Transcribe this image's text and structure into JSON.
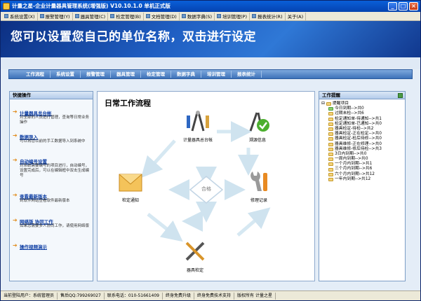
{
  "window": {
    "title": "计量之星-企业计量器具管理系统(增强版)  V10.10.1.0 单机正式版"
  },
  "menu": [
    "系统设置(X)",
    "报警管理(Y)",
    "器具管理(C)",
    "检定管理(B)",
    "文档管理(D)",
    "数据字典(S)",
    "培训管理(P)",
    "报表统计(R)",
    "关于(A)"
  ],
  "banner": {
    "text": "您可以设置您自己的单位名称，双击进行设定"
  },
  "nav": [
    "工作流程",
    "系统设置",
    "报警管理",
    "器具管理",
    "检定管理",
    "数据字典",
    "培训管理",
    "报表统计"
  ],
  "left_panel": {
    "title": "快捷操作",
    "items": [
      {
        "title": "计量器具总台帐",
        "desc": "对全部的人员进行管理，查询等日常业务操作"
      },
      {
        "title": "数据导入",
        "desc": "可以将您以前的手工数据导入到系统中"
      },
      {
        "title": "自动编号设置",
        "desc": "对系统需要编号的项目进行，自动编号，设置完成后，可以在编辑框中双击生成编号"
      },
      {
        "title": "查看最新版本",
        "desc": "到软件网站查看软件最新版本"
      },
      {
        "title": "网络版   协同工作",
        "desc": "如果您需要多人协同工作，请使用网络版"
      },
      {
        "title": "操作视频演示",
        "desc": ""
      }
    ]
  },
  "workflow": {
    "title": "日常工作流程",
    "nodes": {
      "ledger": "计量器具总台帐",
      "repair_info": "溯源信息",
      "notice": "检定通知",
      "center": "合格",
      "repair": "修理记录",
      "verify": "器具检定"
    }
  },
  "right_panel": {
    "title": "工作提醒",
    "root": "提醒项目",
    "items": [
      "今日到期-->共0",
      "过期未检-->共6",
      "检定通知单-待通知-->共1",
      "检定通知单-已通知-->共0",
      "器具检定-待检-->共2",
      "器具检定-正在检定-->共0",
      "器具检定-检后待修-->共0",
      "器具维修-正在修理-->共0",
      "器具维修-修后待检-->共3",
      "3日内到期-->共0",
      "一周内到期-->共0",
      "一个月内到期-->共1",
      "三个月内到期-->共6",
      "六个月内到期-->共12",
      "一年内到期-->共12"
    ]
  },
  "status": [
    "当前登陆用户：系统管理员",
    "售后QQ:799269027",
    "联系电话：010-51661409",
    "终身免费升级",
    "终身免费技术支持",
    "版权所有 计量之星"
  ]
}
